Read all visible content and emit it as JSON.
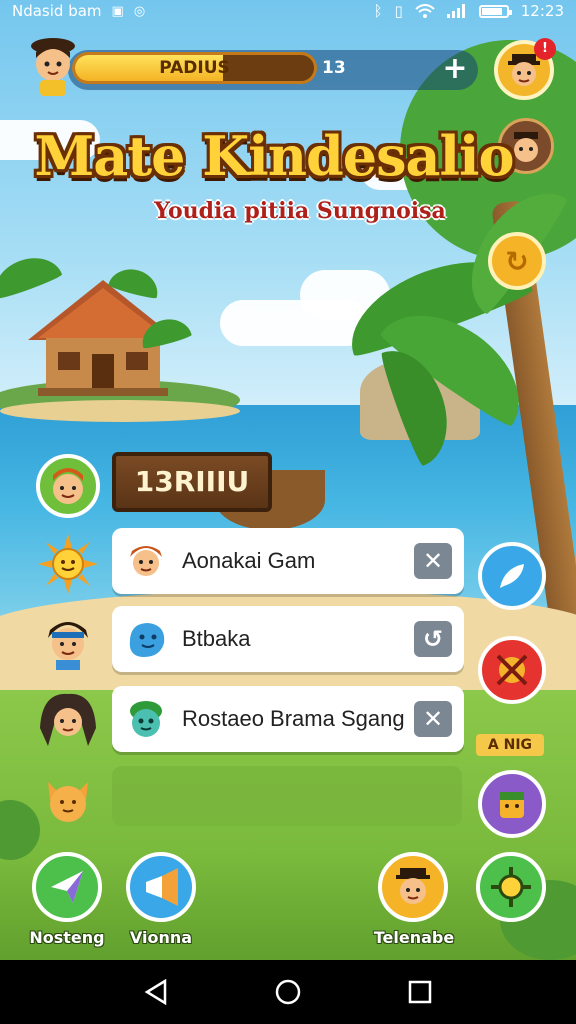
{
  "status_bar": {
    "carrier": "Ndasid bam",
    "time": "12:23",
    "battery_level": 0.85,
    "icons": [
      "notification-icon",
      "whatsapp-icon",
      "bluetooth-icon",
      "vibrate-icon",
      "wifi-icon",
      "signal-icon",
      "battery-icon"
    ]
  },
  "hud": {
    "progress_label": "PADIUS",
    "progress_fraction": 0.62,
    "count": "13",
    "plus_symbol": "+",
    "notification_badge": "!"
  },
  "title": {
    "main": "Mate Kindesalio",
    "subtitle": "Youdia pitiia Sungnoisa"
  },
  "sign": {
    "text": "13RIIIU"
  },
  "list": [
    {
      "label": "Aonakai Gam",
      "action": "close",
      "action_symbol": "✕"
    },
    {
      "label": "Btbaka",
      "action": "refresh",
      "action_symbol": "↺"
    },
    {
      "label": "Rostaeo Brama Sgang",
      "action": "close",
      "action_symbol": "✕"
    }
  ],
  "right_panel": {
    "new_tag": "A NIG"
  },
  "bottom_bar": {
    "left1_label": "Nosteng",
    "left2_label": "Vionna",
    "right1_label": "Telenabe"
  },
  "colors": {
    "accent": "#f5b428",
    "title_fill": "#ffd23a",
    "title_outline": "#6b2f05",
    "subtitle": "#b0201a",
    "action_button": "#7c8794"
  }
}
